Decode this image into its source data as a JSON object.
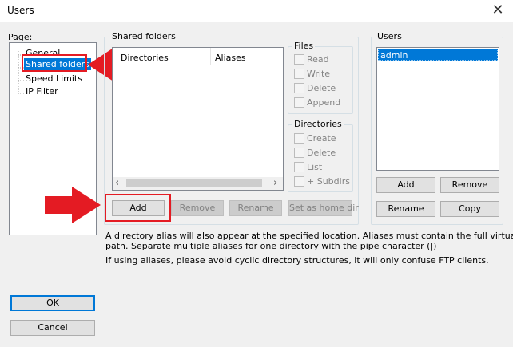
{
  "window": {
    "title": "Users",
    "close_glyph": "✕"
  },
  "page_tree": {
    "label": "Page:",
    "items": [
      {
        "label": "General"
      },
      {
        "label": "Shared folders",
        "selected": true
      },
      {
        "label": "Speed Limits"
      },
      {
        "label": "IP Filter"
      }
    ]
  },
  "shared_folders": {
    "group_label": "Shared folders",
    "columns": [
      "Directories",
      "Aliases"
    ],
    "buttons": {
      "add": "Add",
      "remove": "Remove",
      "rename": "Rename",
      "set_home": "Set as home dir"
    }
  },
  "files": {
    "group_label": "Files",
    "options": [
      "Read",
      "Write",
      "Delete",
      "Append"
    ]
  },
  "directories": {
    "group_label": "Directories",
    "options": [
      "Create",
      "Delete",
      "List",
      "+ Subdirs"
    ]
  },
  "users": {
    "group_label": "Users",
    "list": [
      "admin"
    ],
    "buttons": {
      "add": "Add",
      "remove": "Remove",
      "rename": "Rename",
      "copy": "Copy"
    }
  },
  "info": {
    "line1": "A directory alias will also appear at the specified location. Aliases must contain the full virtual",
    "line2": "path. Separate multiple aliases for one directory with the pipe character (|)",
    "line3": "If using aliases, please avoid cyclic directory structures, it will only confuse FTP clients."
  },
  "dialog_buttons": {
    "ok": "OK",
    "cancel": "Cancel"
  },
  "colors": {
    "accent": "#0078d7",
    "annotation_red": "#e41b23"
  },
  "icons": {
    "scroll_left": "‹",
    "scroll_right": "›"
  }
}
